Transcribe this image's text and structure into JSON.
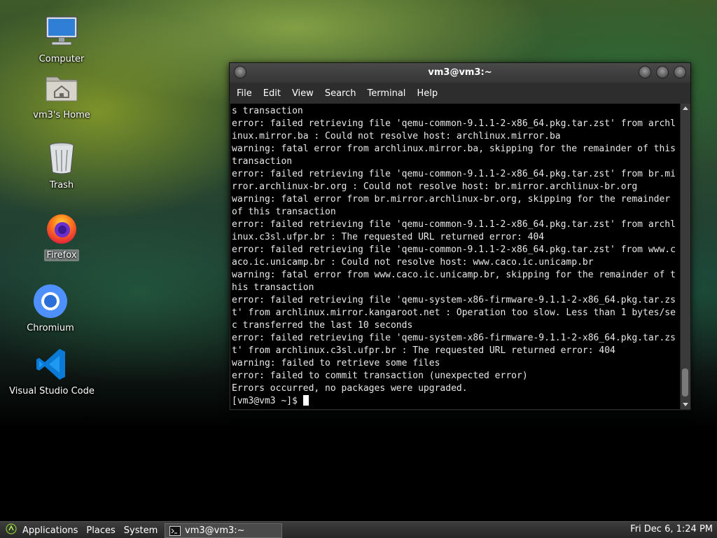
{
  "desktop": {
    "icons": [
      {
        "label": "Computer",
        "icon": "computer-icon"
      },
      {
        "label": "vm3's Home",
        "icon": "home-folder-icon"
      },
      {
        "label": "Trash",
        "icon": "trash-icon"
      },
      {
        "label": "Firefox",
        "icon": "firefox-icon"
      },
      {
        "label": "Chromium",
        "icon": "chromium-icon"
      },
      {
        "label": "Visual Studio Code",
        "icon": "vscode-icon"
      }
    ]
  },
  "terminal": {
    "title": "vm3@vm3:~",
    "menu": [
      "File",
      "Edit",
      "View",
      "Search",
      "Terminal",
      "Help"
    ],
    "output": "s transaction\nerror: failed retrieving file 'qemu-common-9.1.1-2-x86_64.pkg.tar.zst' from archlinux.mirror.ba : Could not resolve host: archlinux.mirror.ba\nwarning: fatal error from archlinux.mirror.ba, skipping for the remainder of this transaction\nerror: failed retrieving file 'qemu-common-9.1.1-2-x86_64.pkg.tar.zst' from br.mirror.archlinux-br.org : Could not resolve host: br.mirror.archlinux-br.org\nwarning: fatal error from br.mirror.archlinux-br.org, skipping for the remainder of this transaction\nerror: failed retrieving file 'qemu-common-9.1.1-2-x86_64.pkg.tar.zst' from archlinux.c3sl.ufpr.br : The requested URL returned error: 404\nerror: failed retrieving file 'qemu-common-9.1.1-2-x86_64.pkg.tar.zst' from www.caco.ic.unicamp.br : Could not resolve host: www.caco.ic.unicamp.br\nwarning: fatal error from www.caco.ic.unicamp.br, skipping for the remainder of this transaction\nerror: failed retrieving file 'qemu-system-x86-firmware-9.1.1-2-x86_64.pkg.tar.zst' from archlinux.mirror.kangaroot.net : Operation too slow. Less than 1 bytes/sec transferred the last 10 seconds\nerror: failed retrieving file 'qemu-system-x86-firmware-9.1.1-2-x86_64.pkg.tar.zst' from archlinux.c3sl.ufpr.br : The requested URL returned error: 404\nwarning: failed to retrieve some files\nerror: failed to commit transaction (unexpected error)\nErrors occurred, no packages were upgraded.",
    "prompt": "[vm3@vm3 ~]$ "
  },
  "panel": {
    "applications": "Applications",
    "places": "Places",
    "system": "System",
    "task_label": "vm3@vm3:~",
    "clock": "Fri Dec  6,  1:24 PM"
  }
}
